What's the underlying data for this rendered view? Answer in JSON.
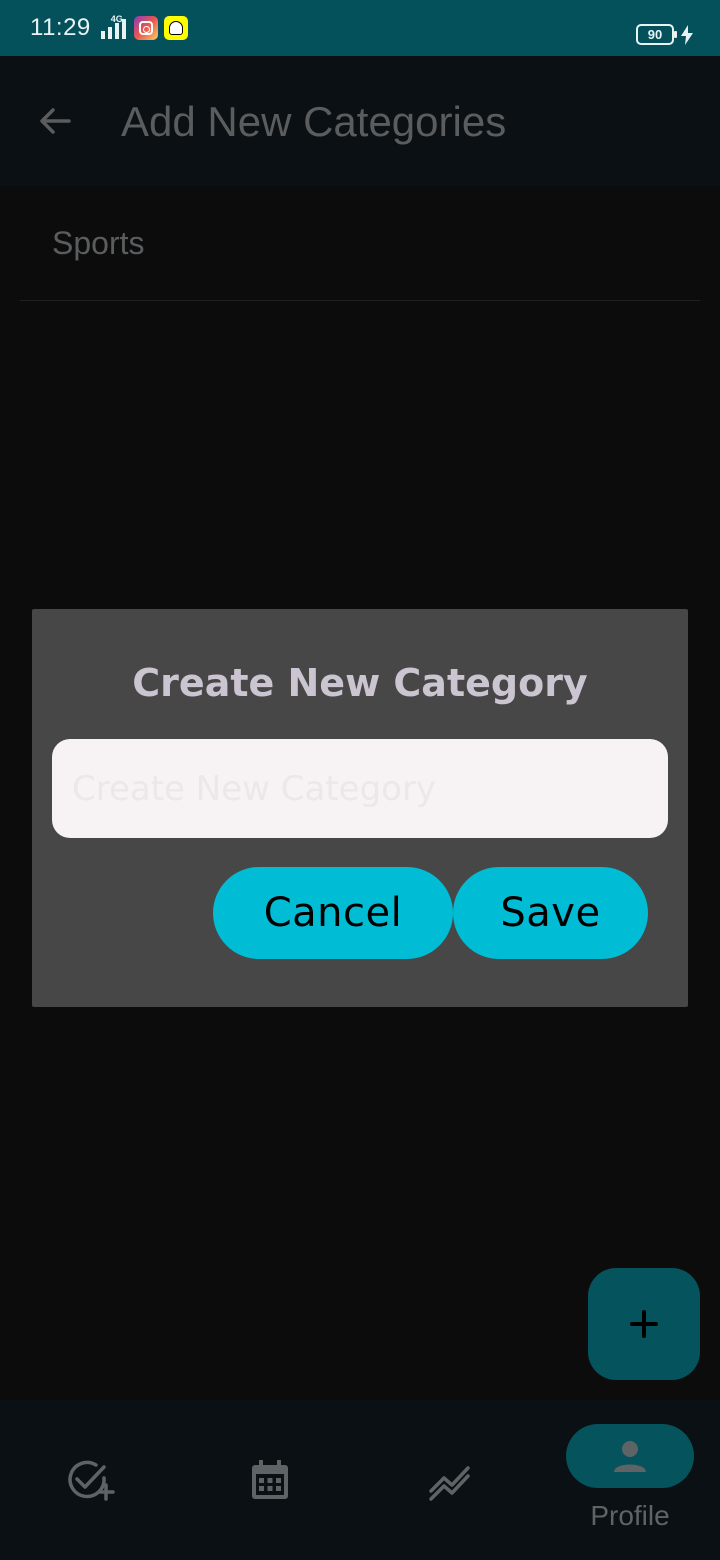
{
  "status_bar": {
    "time": "11:29",
    "network": "4G",
    "battery": "90",
    "app_icons": [
      "instagram-icon",
      "snapchat-icon"
    ]
  },
  "header": {
    "title": "Add New Categories",
    "back_icon": "arrow-left-icon"
  },
  "categories": [
    {
      "label": "Sports"
    }
  ],
  "dialog": {
    "title": "Create New Category",
    "input_placeholder": "Create New Category",
    "input_value": "",
    "cancel_label": "Cancel",
    "save_label": "Save"
  },
  "fab": {
    "icon": "plus-icon"
  },
  "bottom_nav": {
    "items": [
      {
        "icon": "add-task-icon",
        "label": ""
      },
      {
        "icon": "calendar-icon",
        "label": ""
      },
      {
        "icon": "trending-icon",
        "label": ""
      },
      {
        "icon": "person-icon",
        "label": "Profile",
        "active": true
      }
    ]
  },
  "colors": {
    "accent": "#00bcd4",
    "status_bar": "#04515b",
    "dialog_bg": "#474747",
    "fab_bg": "#05535d"
  }
}
